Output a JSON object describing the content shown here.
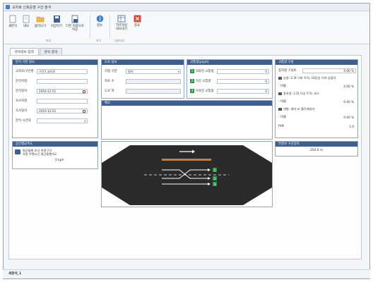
{
  "window": {
    "title": "교차로 신호운영 구간 분석"
  },
  "ribbon": {
    "buttons": [
      {
        "label": "새분석",
        "label2": ""
      },
      {
        "label": "내보",
        "label2": ""
      },
      {
        "label": "불러오기",
        "label2": ""
      },
      {
        "label": "저장하기",
        "label2": ""
      },
      {
        "label": "다른 이름으로",
        "label2": "저장"
      },
      {
        "label": "정보",
        "label2": ""
      },
      {
        "label": "TXT파일",
        "label2": "내보내기"
      },
      {
        "label": "종료",
        "label2": ""
      }
    ],
    "groups": [
      "파일",
      "보기",
      "내보내기"
    ]
  },
  "tabs": [
    "분석정보 입력",
    "분석 결과"
  ],
  "analysis_info": {
    "header": "분석 기본 정보",
    "fields": [
      {
        "label": "교차로/구간명",
        "value": "구간1 교차로"
      },
      {
        "label": "분석자명",
        "value": ""
      },
      {
        "label": "분석일자",
        "value": "2016-12-01"
      },
      {
        "label": "조사자명",
        "value": ""
      },
      {
        "label": "조사일자",
        "value": "2016-12-01"
      },
      {
        "label": "분석 시간대",
        "value": ""
      }
    ]
  },
  "road_info": {
    "header": "도로 정보",
    "fields": [
      {
        "label": "지형 구분",
        "value": "평지"
      },
      {
        "label": "차로 수",
        "value": ""
      },
      {
        "label": "도로 폭",
        "value": ""
      }
    ]
  },
  "volume_info": {
    "header": "교통량(pcph)",
    "rows": [
      {
        "num": "1",
        "label": "좌회전 교통량",
        "value": "0"
      },
      {
        "num": "2",
        "label": "직진 교통량",
        "value": "0"
      },
      {
        "num": "3",
        "label": "우회전 교통량",
        "value": "0"
      }
    ]
  },
  "memo": {
    "header": "메모"
  },
  "vehicle_ratio": {
    "header": "교통량 구성",
    "fields": [
      {
        "label": "중차량 구성비",
        "value": "0.00 %"
      },
      {
        "label": "승용: 2.5t 이하 트럭, 16인승 이하 승합차",
        "value": ""
      },
      {
        "label": "- 비율",
        "value": "0.00 %"
      },
      {
        "label": "중차량: 2.5t 이상 트럭, 버스",
        "value": ""
      },
      {
        "label": "- 비율",
        "value": "0.00 %"
      },
      {
        "label": "대형: 세미 or 풀트레일러",
        "value": ""
      },
      {
        "label": "- 비율",
        "value": "0.00 %"
      },
      {
        "label": "PHF",
        "value": "1.0"
      }
    ]
  },
  "space_mean": {
    "header": "공간평균속도",
    "text1": "평균통행 조사 측정구간",
    "text2": "차량 주행시간 평균통행속도",
    "value": "0",
    "unit": "kph"
  },
  "section_speed": {
    "header": "연결로 구간길이",
    "value": "250.0",
    "unit": "m"
  },
  "diagram": {
    "labels": [
      "1",
      "2",
      "3"
    ]
  },
  "status": {
    "text": "새분석_1"
  },
  "colors": {
    "header_blue": "#3d5f92",
    "road": "#2b2b2b",
    "accent_orange": "#e07a1a",
    "arrow_green": "#2f9a4a"
  }
}
